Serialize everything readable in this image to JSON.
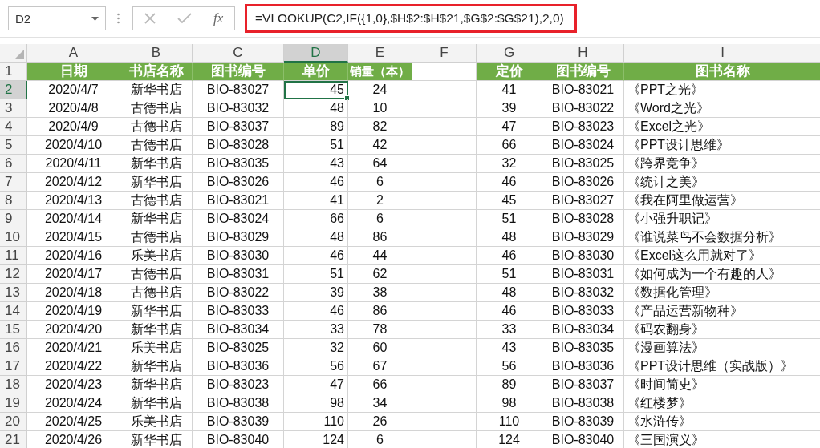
{
  "formula_bar": {
    "name_box": "D2",
    "fx": "fx",
    "formula": "=VLOOKUP(C2,IF({1,0},$H$2:$H$21,$G$2:$G$21),2,0)"
  },
  "columns": [
    {
      "label": "A",
      "selected": false
    },
    {
      "label": "B",
      "selected": false
    },
    {
      "label": "C",
      "selected": false
    },
    {
      "label": "D",
      "selected": true
    },
    {
      "label": "E",
      "selected": false
    },
    {
      "label": "F",
      "selected": false
    },
    {
      "label": "G",
      "selected": false
    },
    {
      "label": "H",
      "selected": false
    },
    {
      "label": "I",
      "selected": false
    }
  ],
  "header_row": {
    "number": "1",
    "sales": [
      "日期",
      "书店名称",
      "图书编号",
      "单价",
      "销量（本）"
    ],
    "catalog": [
      "定价",
      "图书编号",
      "图书名称"
    ]
  },
  "rows": [
    {
      "number": "2",
      "selected": true,
      "sales": [
        "2020/4/7",
        "新华书店",
        "BIO-83027",
        "45",
        "24"
      ],
      "catalog": [
        "41",
        "BIO-83021",
        "《PPT之光》"
      ]
    },
    {
      "number": "3",
      "selected": false,
      "sales": [
        "2020/4/8",
        "古德书店",
        "BIO-83032",
        "48",
        "10"
      ],
      "catalog": [
        "39",
        "BIO-83022",
        "《Word之光》"
      ]
    },
    {
      "number": "4",
      "selected": false,
      "sales": [
        "2020/4/9",
        "古德书店",
        "BIO-83037",
        "89",
        "82"
      ],
      "catalog": [
        "47",
        "BIO-83023",
        "《Excel之光》"
      ]
    },
    {
      "number": "5",
      "selected": false,
      "sales": [
        "2020/4/10",
        "古德书店",
        "BIO-83028",
        "51",
        "42"
      ],
      "catalog": [
        "66",
        "BIO-83024",
        "《PPT设计思维》"
      ]
    },
    {
      "number": "6",
      "selected": false,
      "sales": [
        "2020/4/11",
        "新华书店",
        "BIO-83035",
        "43",
        "64"
      ],
      "catalog": [
        "32",
        "BIO-83025",
        "《跨界竞争》"
      ]
    },
    {
      "number": "7",
      "selected": false,
      "sales": [
        "2020/4/12",
        "新华书店",
        "BIO-83026",
        "46",
        "6"
      ],
      "catalog": [
        "46",
        "BIO-83026",
        "《统计之美》"
      ]
    },
    {
      "number": "8",
      "selected": false,
      "sales": [
        "2020/4/13",
        "古德书店",
        "BIO-83021",
        "41",
        "2"
      ],
      "catalog": [
        "45",
        "BIO-83027",
        "《我在阿里做运营》"
      ]
    },
    {
      "number": "9",
      "selected": false,
      "sales": [
        "2020/4/14",
        "新华书店",
        "BIO-83024",
        "66",
        "6"
      ],
      "catalog": [
        "51",
        "BIO-83028",
        "《小强升职记》"
      ]
    },
    {
      "number": "10",
      "selected": false,
      "sales": [
        "2020/4/15",
        "古德书店",
        "BIO-83029",
        "48",
        "86"
      ],
      "catalog": [
        "48",
        "BIO-83029",
        "《谁说菜鸟不会数据分析》"
      ]
    },
    {
      "number": "11",
      "selected": false,
      "sales": [
        "2020/4/16",
        "乐美书店",
        "BIO-83030",
        "46",
        "44"
      ],
      "catalog": [
        "46",
        "BIO-83030",
        "《Excel这么用就对了》"
      ]
    },
    {
      "number": "12",
      "selected": false,
      "sales": [
        "2020/4/17",
        "古德书店",
        "BIO-83031",
        "51",
        "62"
      ],
      "catalog": [
        "51",
        "BIO-83031",
        "《如何成为一个有趣的人》"
      ]
    },
    {
      "number": "13",
      "selected": false,
      "sales": [
        "2020/4/18",
        "古德书店",
        "BIO-83022",
        "39",
        "38"
      ],
      "catalog": [
        "48",
        "BIO-83032",
        "《数据化管理》"
      ]
    },
    {
      "number": "14",
      "selected": false,
      "sales": [
        "2020/4/19",
        "新华书店",
        "BIO-83033",
        "46",
        "86"
      ],
      "catalog": [
        "46",
        "BIO-83033",
        "《产品运营新物种》"
      ]
    },
    {
      "number": "15",
      "selected": false,
      "sales": [
        "2020/4/20",
        "新华书店",
        "BIO-83034",
        "33",
        "78"
      ],
      "catalog": [
        "33",
        "BIO-83034",
        "《码农翻身》"
      ]
    },
    {
      "number": "16",
      "selected": false,
      "sales": [
        "2020/4/21",
        "乐美书店",
        "BIO-83025",
        "32",
        "60"
      ],
      "catalog": [
        "43",
        "BIO-83035",
        "《漫画算法》"
      ]
    },
    {
      "number": "17",
      "selected": false,
      "sales": [
        "2020/4/22",
        "新华书店",
        "BIO-83036",
        "56",
        "67"
      ],
      "catalog": [
        "56",
        "BIO-83036",
        "《PPT设计思维（实战版）》"
      ]
    },
    {
      "number": "18",
      "selected": false,
      "sales": [
        "2020/4/23",
        "新华书店",
        "BIO-83023",
        "47",
        "66"
      ],
      "catalog": [
        "89",
        "BIO-83037",
        "《时间简史》"
      ]
    },
    {
      "number": "19",
      "selected": false,
      "sales": [
        "2020/4/24",
        "新华书店",
        "BIO-83038",
        "98",
        "34"
      ],
      "catalog": [
        "98",
        "BIO-83038",
        "《红楼梦》"
      ]
    },
    {
      "number": "20",
      "selected": false,
      "sales": [
        "2020/4/25",
        "乐美书店",
        "BIO-83039",
        "110",
        "26"
      ],
      "catalog": [
        "110",
        "BIO-83039",
        "《水浒传》"
      ]
    },
    {
      "number": "21",
      "selected": false,
      "sales": [
        "2020/4/26",
        "新华书店",
        "BIO-83040",
        "124",
        "6"
      ],
      "catalog": [
        "124",
        "BIO-83040",
        "《三国演义》"
      ]
    }
  ]
}
